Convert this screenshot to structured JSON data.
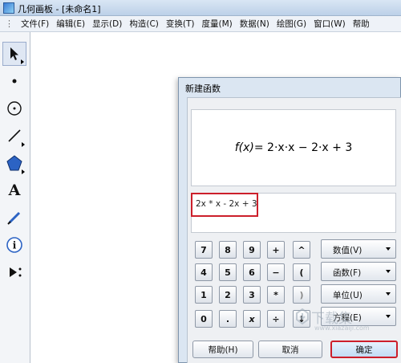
{
  "window": {
    "title": "几何画板 - [未命名1]"
  },
  "menu": [
    "文件(F)",
    "编辑(E)",
    "显示(D)",
    "构造(C)",
    "变换(T)",
    "度量(M)",
    "数据(N)",
    "绘图(G)",
    "窗口(W)",
    "帮助"
  ],
  "toolbox": {
    "tools": [
      {
        "name": "arrow-select-icon"
      },
      {
        "name": "point-icon"
      },
      {
        "name": "compass-circle-icon"
      },
      {
        "name": "line-segment-icon"
      },
      {
        "name": "polygon-icon"
      },
      {
        "name": "text-icon",
        "glyph": "A"
      },
      {
        "name": "marker-pen-icon"
      },
      {
        "name": "information-icon",
        "glyph": "i"
      },
      {
        "name": "custom-tool-icon"
      }
    ]
  },
  "dialog": {
    "title": "新建函数",
    "preview": {
      "fx": "f(x)",
      "rhs": " = 2·x·x − 2·x + 3"
    },
    "expression": "2x * x - 2x + 3",
    "keypad": {
      "rows": [
        [
          "7",
          "8",
          "9",
          "+",
          "^"
        ],
        [
          "4",
          "5",
          "6",
          "−",
          "("
        ],
        [
          "1",
          "2",
          "3",
          "*",
          ")"
        ],
        [
          "0",
          ".",
          "x",
          "÷",
          "↓"
        ]
      ]
    },
    "dropdowns": [
      "数值(V)",
      "函数(F)",
      "单位(U)",
      "方程(E)"
    ],
    "buttons": {
      "help": "帮助(H)",
      "cancel": "取消",
      "ok": "确定"
    }
  },
  "watermark": {
    "main": "下载集",
    "sub": "www.xiazaiji.com"
  }
}
